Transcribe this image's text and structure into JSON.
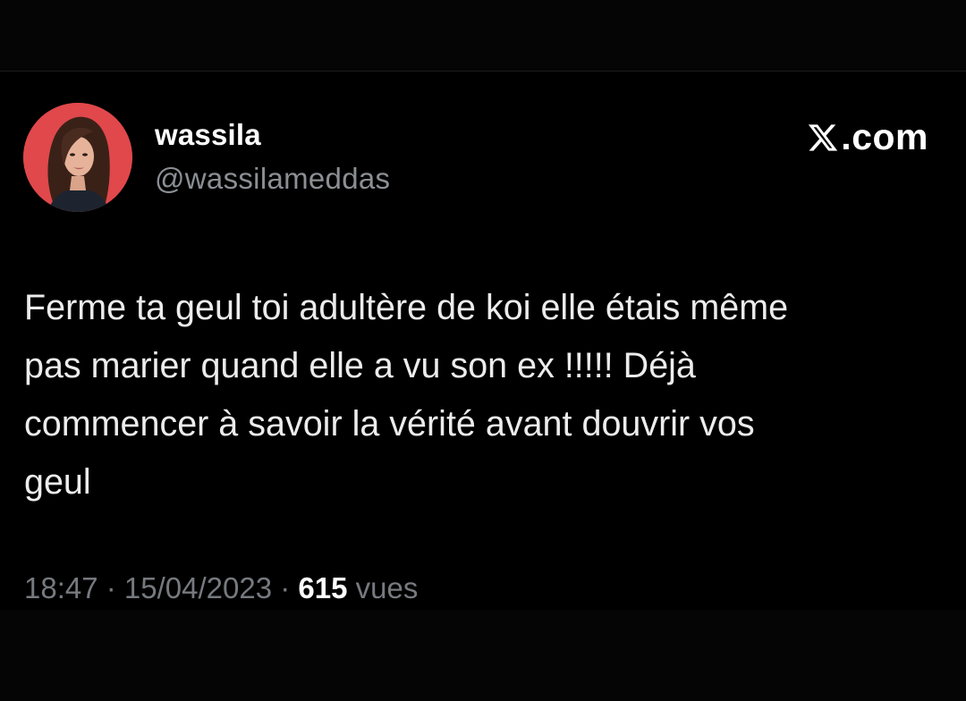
{
  "tweet": {
    "author": {
      "display_name": "wassila",
      "handle": "@wassilameddas",
      "avatar_icon": "profile-photo"
    },
    "brand": {
      "icon": "x-logo-icon",
      "text": ".com"
    },
    "text": "Ferme ta geul toi adultère de koi elle étais même\npas marier quand elle a vu son ex !!!!! Déjà\ncommencer à savoir la vérité avant douvrir vos\ngeul",
    "meta": {
      "time": "18:47",
      "separator": " · ",
      "date": "15/04/2023",
      "views_count": "615",
      "views_label": " vues"
    }
  },
  "colors": {
    "background": "#000000",
    "text": "#e7e9ea",
    "secondary_text": "#767a7f",
    "avatar_ring": "#e04a4a"
  }
}
